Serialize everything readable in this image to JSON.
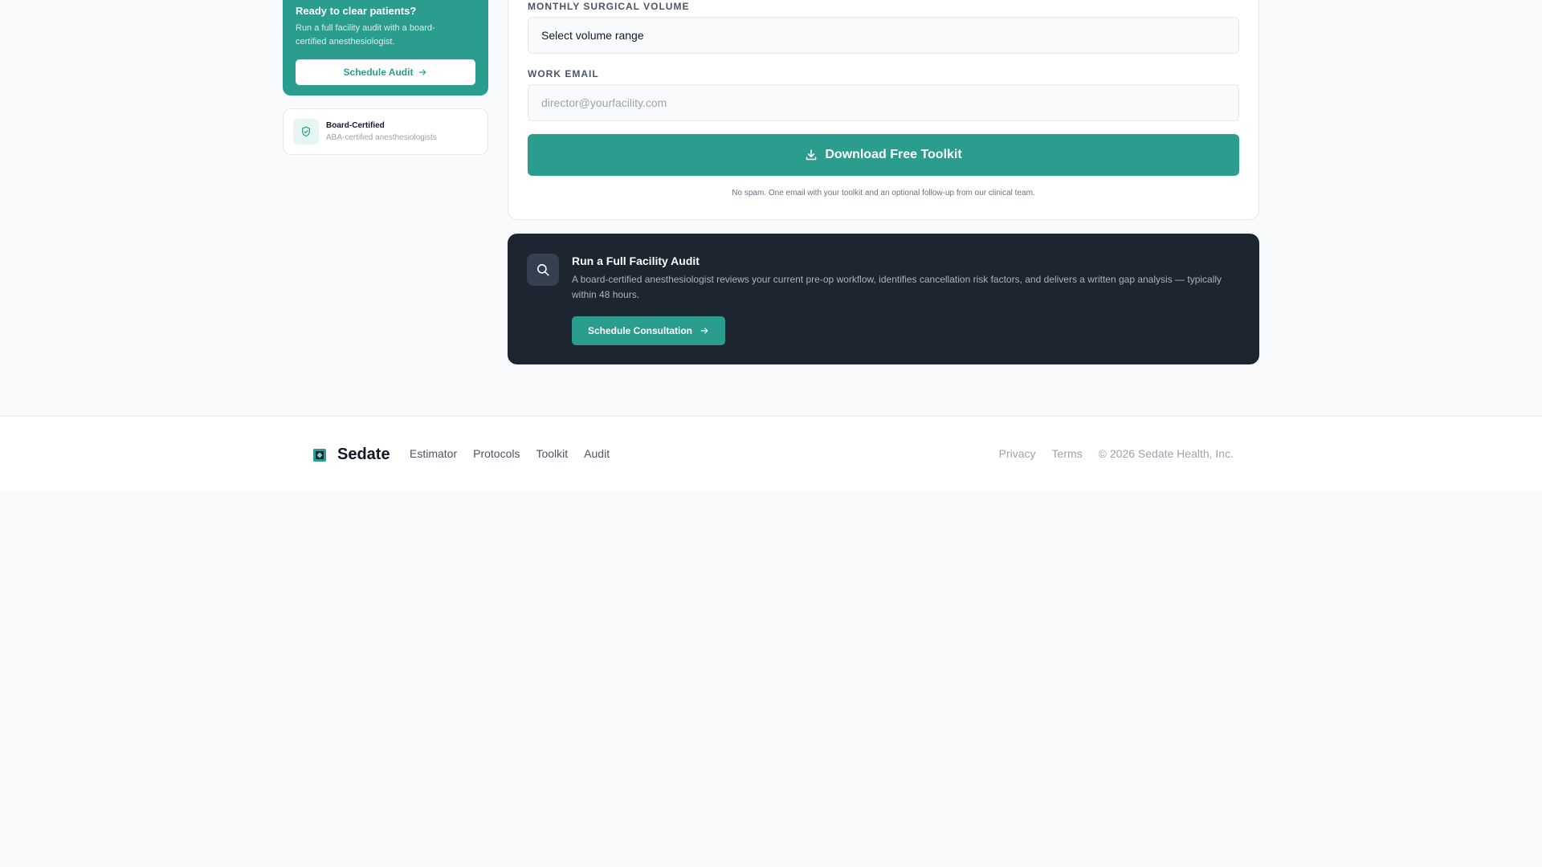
{
  "sidebar": {
    "cta": {
      "title": "Ready to clear patients?",
      "text": "Run a full facility audit with a board-certified anesthesiologist.",
      "button_label": "Schedule Audit"
    },
    "trust": {
      "title": "Board-Certified",
      "subtitle": "ABA-certified anesthesiologists"
    }
  },
  "form": {
    "volume_label": "MONTHLY SURGICAL VOLUME",
    "volume_value": "Select volume range",
    "email_label": "WORK EMAIL",
    "email_placeholder": "director@yourfacility.com",
    "submit_label": "Download Free Toolkit",
    "disclaimer": "No spam. One email with your toolkit and an optional follow-up from our clinical team."
  },
  "audit": {
    "title": "Run a Full Facility Audit",
    "description": "A board-certified anesthesiologist reviews your current pre-op workflow, identifies cancellation risk factors, and delivers a written gap analysis — typically within 48 hours.",
    "button_label": "Schedule Consultation"
  },
  "footer": {
    "brand": "Sedate",
    "nav": [
      "Estimator",
      "Protocols",
      "Toolkit",
      "Audit"
    ],
    "privacy": "Privacy",
    "terms": "Terms",
    "copyright": "© 2026 Sedate Health, Inc."
  },
  "colors": {
    "accent": "#2a9d8f",
    "dark_card": "#1c2530",
    "page_bg": "#f9fafb"
  }
}
